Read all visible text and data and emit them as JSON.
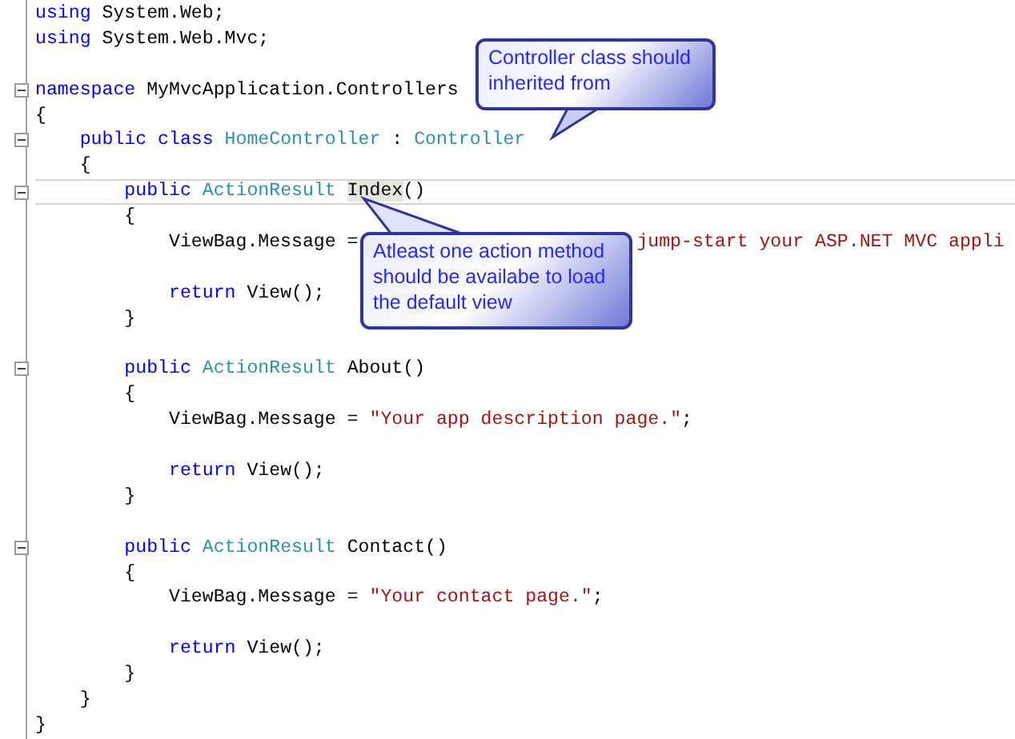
{
  "code_lines": [
    {
      "fold": false,
      "current": false,
      "tokens": [
        {
          "kind": "keyword",
          "text": "using"
        },
        {
          "kind": "plain",
          "text": " System.Web;"
        }
      ]
    },
    {
      "fold": false,
      "current": false,
      "tokens": [
        {
          "kind": "keyword",
          "text": "using"
        },
        {
          "kind": "plain",
          "text": " System.Web.Mvc;"
        }
      ]
    },
    {
      "fold": false,
      "current": false
    },
    {
      "fold": true,
      "current": false,
      "tokens": [
        {
          "kind": "keyword",
          "text": "namespace"
        },
        {
          "kind": "plain",
          "text": " MyMvcApplication.Controllers"
        }
      ]
    },
    {
      "fold": false,
      "current": false,
      "tokens": [
        {
          "kind": "plain",
          "text": "{"
        }
      ]
    },
    {
      "fold": true,
      "current": false,
      "tokens": [
        {
          "kind": "keyword",
          "text": "    public class "
        },
        {
          "kind": "type",
          "text": "HomeController"
        },
        {
          "kind": "plain",
          "text": " : "
        },
        {
          "kind": "type",
          "text": "Controller"
        }
      ]
    },
    {
      "fold": false,
      "current": false,
      "tokens": [
        {
          "kind": "plain",
          "text": "    {"
        }
      ]
    },
    {
      "fold": true,
      "current": true,
      "tokens": [
        {
          "kind": "keyword",
          "text": "        public "
        },
        {
          "kind": "type",
          "text": "ActionResult "
        },
        {
          "kind": "highlight",
          "text": "Index"
        },
        {
          "kind": "plain",
          "text": "()"
        }
      ]
    },
    {
      "fold": false,
      "current": false,
      "tokens": [
        {
          "kind": "plain",
          "text": "        {"
        }
      ]
    },
    {
      "fold": false,
      "current": false,
      "tokens": [
        {
          "kind": "plain",
          "text": "            ViewBag.Message ="
        },
        {
          "kind": "hidden_string",
          "text": "jump-start your ASP.NET MVC appli"
        }
      ]
    },
    {
      "fold": false,
      "current": false
    },
    {
      "fold": false,
      "current": false,
      "tokens": [
        {
          "kind": "keyword",
          "text": "            return"
        },
        {
          "kind": "plain",
          "text": " View();"
        }
      ]
    },
    {
      "fold": false,
      "current": false,
      "tokens": [
        {
          "kind": "plain",
          "text": "        }"
        }
      ]
    },
    {
      "fold": false,
      "current": false
    },
    {
      "fold": true,
      "current": false,
      "tokens": [
        {
          "kind": "keyword",
          "text": "        public "
        },
        {
          "kind": "type",
          "text": "ActionResult"
        },
        {
          "kind": "plain",
          "text": " About()"
        }
      ]
    },
    {
      "fold": false,
      "current": false,
      "tokens": [
        {
          "kind": "plain",
          "text": "        {"
        }
      ]
    },
    {
      "fold": false,
      "current": false,
      "tokens": [
        {
          "kind": "plain",
          "text": "            ViewBag.Message = "
        },
        {
          "kind": "string",
          "text": "\"Your app description page.\""
        },
        {
          "kind": "plain",
          "text": ";"
        }
      ]
    },
    {
      "fold": false,
      "current": false
    },
    {
      "fold": false,
      "current": false,
      "tokens": [
        {
          "kind": "keyword",
          "text": "            return"
        },
        {
          "kind": "plain",
          "text": " View();"
        }
      ]
    },
    {
      "fold": false,
      "current": false,
      "tokens": [
        {
          "kind": "plain",
          "text": "        }"
        }
      ]
    },
    {
      "fold": false,
      "current": false
    },
    {
      "fold": true,
      "current": false,
      "tokens": [
        {
          "kind": "keyword",
          "text": "        public "
        },
        {
          "kind": "type",
          "text": "ActionResult"
        },
        {
          "kind": "plain",
          "text": " Contact()"
        }
      ]
    },
    {
      "fold": false,
      "current": false,
      "tokens": [
        {
          "kind": "plain",
          "text": "        {"
        }
      ]
    },
    {
      "fold": false,
      "current": false,
      "tokens": [
        {
          "kind": "plain",
          "text": "            ViewBag.Message = "
        },
        {
          "kind": "string",
          "text": "\"Your contact page.\""
        },
        {
          "kind": "plain",
          "text": ";"
        }
      ]
    },
    {
      "fold": false,
      "current": false
    },
    {
      "fold": false,
      "current": false,
      "tokens": [
        {
          "kind": "keyword",
          "text": "            return"
        },
        {
          "kind": "plain",
          "text": " View();"
        }
      ]
    },
    {
      "fold": false,
      "current": false,
      "tokens": [
        {
          "kind": "plain",
          "text": "        }"
        }
      ]
    },
    {
      "fold": false,
      "current": false,
      "tokens": [
        {
          "kind": "plain",
          "text": "    }"
        }
      ]
    },
    {
      "fold": false,
      "current": false,
      "tokens": [
        {
          "kind": "plain",
          "text": "}"
        }
      ]
    }
  ],
  "callouts": [
    {
      "text": "Controller class should inherited from"
    },
    {
      "text": "Atleast one action method should be availabe to load the default view"
    }
  ]
}
